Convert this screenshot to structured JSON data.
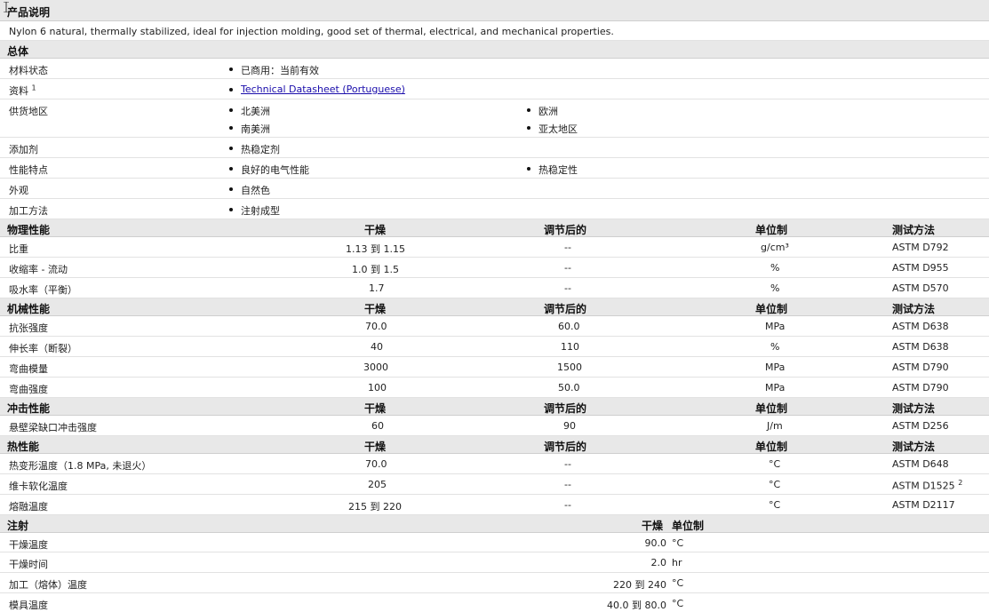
{
  "sections": {
    "product": "产品说明",
    "description": "Nylon 6 natural, thermally stabilized, ideal for injection molding, good set of thermal, electrical, and mechanical properties.",
    "general": "总体",
    "physical": "物理性能",
    "mechanical": "机械性能",
    "impact": "冲击性能",
    "thermal": "热性能",
    "injection": "注射"
  },
  "col_headers": {
    "dry": "干燥",
    "conditioned": "调节后的",
    "unit": "单位制",
    "method": "测试方法"
  },
  "general": [
    {
      "label": "材料状态",
      "values": [
        "已商用：当前有效"
      ]
    },
    {
      "label": "资料",
      "sup": "1",
      "values": [
        "Technical Datasheet (Portuguese)"
      ]
    },
    {
      "label": "供货地区",
      "values": [
        "北美洲",
        "欧洲",
        "南美洲",
        "亚太地区"
      ]
    },
    {
      "label": "添加剂",
      "values": [
        "热稳定剂"
      ]
    },
    {
      "label": "性能特点",
      "values": [
        "良好的电气性能",
        "热稳定性"
      ]
    },
    {
      "label": "外观",
      "values": [
        "自然色"
      ]
    },
    {
      "label": "加工方法",
      "values": [
        "注射成型"
      ]
    }
  ],
  "physical": [
    {
      "label": "比重",
      "dry": "1.13 到  1.15",
      "cond": "--",
      "unit": "g/cm³",
      "method": "ASTM D792"
    },
    {
      "label": "收缩率 - 流动",
      "dry": "1.0 到  1.5",
      "cond": "--",
      "unit": "%",
      "method": "ASTM D955"
    },
    {
      "label": "吸水率（平衡）",
      "dry": "1.7",
      "cond": "--",
      "unit": "%",
      "method": "ASTM D570"
    }
  ],
  "mechanical": [
    {
      "label": "抗张强度",
      "dry": "70.0",
      "cond": "60.0",
      "unit": "MPa",
      "method": "ASTM D638"
    },
    {
      "label": "伸长率（断裂）",
      "dry": "40",
      "cond": "110",
      "unit": "%",
      "method": "ASTM D638"
    },
    {
      "label": "弯曲模量",
      "dry": "3000",
      "cond": "1500",
      "unit": "MPa",
      "method": "ASTM D790"
    },
    {
      "label": "弯曲强度",
      "dry": "100",
      "cond": "50.0",
      "unit": "MPa",
      "method": "ASTM D790"
    }
  ],
  "impact": [
    {
      "label": "悬壁梁缺口冲击强度",
      "dry": "60",
      "cond": "90",
      "unit": "J/m",
      "method": "ASTM D256"
    }
  ],
  "thermal": [
    {
      "label": "热变形温度（1.8 MPa, 未退火）",
      "dry": "70.0",
      "cond": "--",
      "unit": "°C",
      "method": "ASTM D648"
    },
    {
      "label": "维卡软化温度",
      "dry": "205",
      "cond": "--",
      "unit": "°C",
      "method": "ASTM D1525",
      "sup": "2"
    },
    {
      "label": "熔融温度",
      "dry": "215 到  220",
      "cond": "--",
      "unit": "°C",
      "method": "ASTM D2117"
    }
  ],
  "injection_headers": {
    "dry": "干燥",
    "unit": "单位制"
  },
  "injection": [
    {
      "label": "干燥温度",
      "dry": "90.0",
      "unit": "°C"
    },
    {
      "label": "干燥时间",
      "dry": "2.0",
      "unit": "hr"
    },
    {
      "label": "加工（熔体）温度",
      "dry": "220 到  240",
      "unit": "°C"
    },
    {
      "label": "模具温度",
      "dry": "40.0 到  80.0",
      "unit": "°C"
    }
  ]
}
